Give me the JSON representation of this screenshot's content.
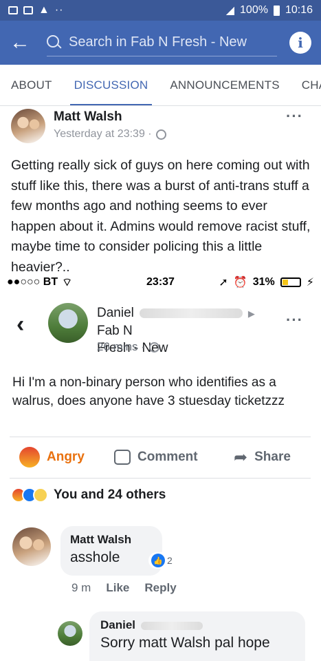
{
  "status_bar": {
    "battery": "100%",
    "time": "10:16",
    "dots": "··"
  },
  "app_bar": {
    "search_placeholder": "Search in Fab N Fresh - New"
  },
  "tabs": [
    {
      "label": "ABOUT"
    },
    {
      "label": "DISCUSSION",
      "active": true
    },
    {
      "label": "ANNOUNCEMENTS"
    },
    {
      "label": "CHA"
    }
  ],
  "post": {
    "author": "Matt Walsh",
    "timestamp": "Yesterday at 23:39 ·",
    "more": "···",
    "text": "Getting really sick of guys on here coming out with stuff like this, there was a burst of anti-trans stuff a few months ago and nothing seems to ever happen about it. Admins would remove racist stuff, maybe time to consider policing this a little heavier?.."
  },
  "embed": {
    "ios_status": {
      "carrier": "●●○○○ BT",
      "time": "23:37",
      "battery": "31%"
    },
    "author_first": "Daniel",
    "arrow": "▶",
    "group": "Fab N",
    "group_cont": "Fresh - New",
    "timestamp": "26 mins ·",
    "text": "Hi I'm a non-binary person who identifies as a walrus, does anyone have 3 stuesday ticketzzz",
    "actions": {
      "angry": "Angry",
      "comment": "Comment",
      "share": "Share"
    },
    "reactions_summary": "You and 24 others",
    "comments": [
      {
        "author": "Matt Walsh",
        "text": "asshole",
        "likes": "2",
        "age": "9 m",
        "like_label": "Like",
        "reply_label": "Reply"
      },
      {
        "author": "Daniel",
        "text": "Sorry matt Walsh pal hope"
      }
    ]
  },
  "colors": {
    "facebook_blue": "#4267b2",
    "angry_orange": "#e9710f"
  }
}
